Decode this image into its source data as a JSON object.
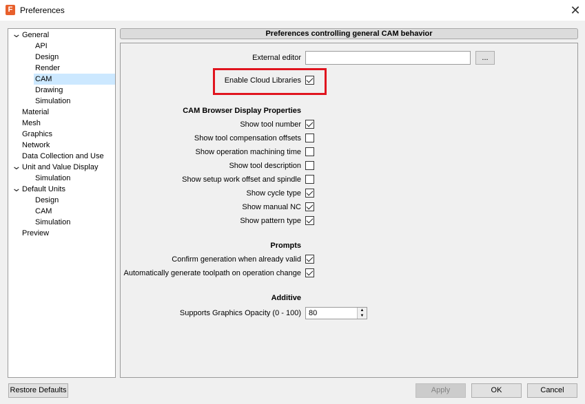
{
  "window": {
    "title": "Preferences",
    "app_icon_letter": "F"
  },
  "tree": [
    {
      "label": "General",
      "indent": 0,
      "expanded": true
    },
    {
      "label": "API",
      "indent": 1
    },
    {
      "label": "Design",
      "indent": 1
    },
    {
      "label": "Render",
      "indent": 1
    },
    {
      "label": "CAM",
      "indent": 1,
      "selected": true
    },
    {
      "label": "Drawing",
      "indent": 1
    },
    {
      "label": "Simulation",
      "indent": 1
    },
    {
      "label": "Material",
      "indent": 0
    },
    {
      "label": "Mesh",
      "indent": 0
    },
    {
      "label": "Graphics",
      "indent": 0
    },
    {
      "label": "Network",
      "indent": 0
    },
    {
      "label": "Data Collection and Use",
      "indent": 0
    },
    {
      "label": "Unit and Value Display",
      "indent": 0,
      "expanded": true
    },
    {
      "label": "Simulation",
      "indent": 1
    },
    {
      "label": "Default Units",
      "indent": 0,
      "expanded": true
    },
    {
      "label": "Design",
      "indent": 1
    },
    {
      "label": "CAM",
      "indent": 1
    },
    {
      "label": "Simulation",
      "indent": 1
    },
    {
      "label": "Preview",
      "indent": 0
    }
  ],
  "panel": {
    "header": "Preferences controlling general CAM behavior",
    "external_editor": {
      "label": "External editor",
      "value": "",
      "browse_label": "..."
    },
    "cloud_libraries": {
      "label": "Enable Cloud Libraries",
      "checked": true
    },
    "browser_section": {
      "title": "CAM Browser Display Properties",
      "options": [
        {
          "label": "Show tool number",
          "checked": true
        },
        {
          "label": "Show tool compensation offsets",
          "checked": false
        },
        {
          "label": "Show operation machining time",
          "checked": false
        },
        {
          "label": "Show tool description",
          "checked": false
        },
        {
          "label": "Show setup work offset and spindle",
          "checked": false
        },
        {
          "label": "Show cycle type",
          "checked": true
        },
        {
          "label": "Show manual NC",
          "checked": true
        },
        {
          "label": "Show pattern type",
          "checked": true
        }
      ]
    },
    "prompts_section": {
      "title": "Prompts",
      "options": [
        {
          "label": "Confirm generation when already valid",
          "checked": true
        },
        {
          "label": "Automatically generate toolpath on operation change",
          "checked": true
        }
      ]
    },
    "additive_section": {
      "title": "Additive",
      "opacity": {
        "label": "Supports Graphics Opacity (0 - 100)",
        "value": "80"
      }
    }
  },
  "footer": {
    "restore_label": "Restore Defaults",
    "apply_label": "Apply",
    "ok_label": "OK",
    "cancel_label": "Cancel"
  },
  "colors": {
    "highlight": "#e0141e",
    "selection": "#cce8ff",
    "app_icon": "#e8602c"
  }
}
